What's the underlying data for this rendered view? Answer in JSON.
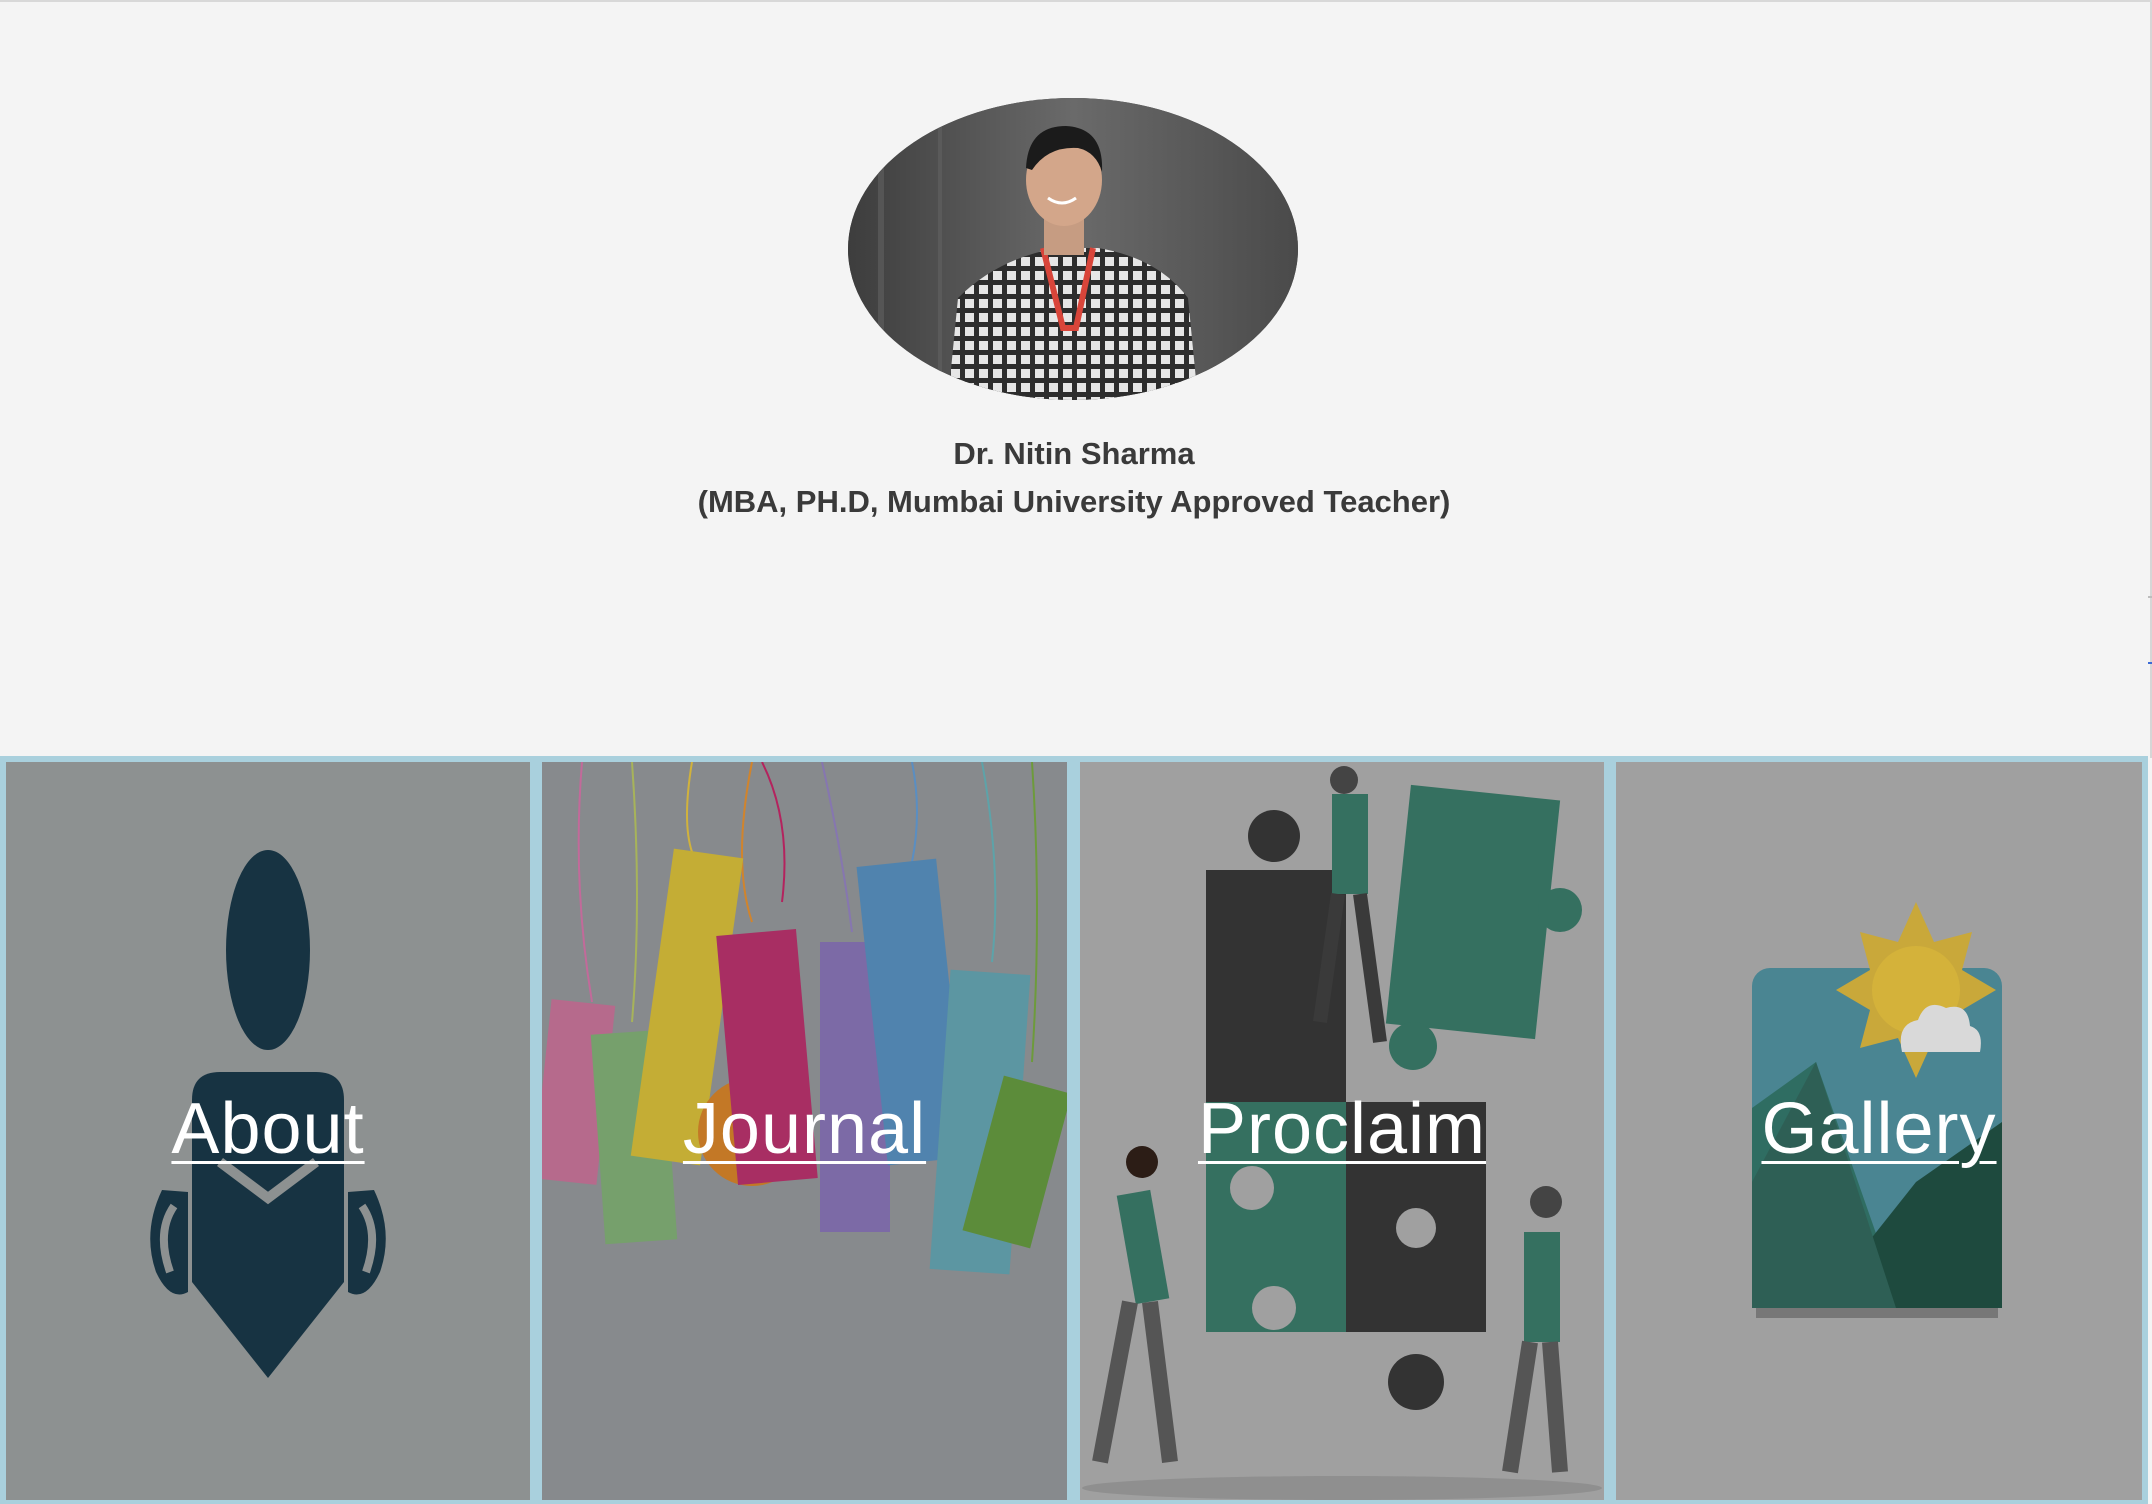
{
  "profile": {
    "name": "Dr. Nitin Sharma",
    "credentials": "(MBA, PH.D, Mumbai University Approved Teacher)"
  },
  "nav_tiles": [
    {
      "label": "About"
    },
    {
      "label": "Journal"
    },
    {
      "label": "Proclaim"
    },
    {
      "label": "Gallery"
    }
  ],
  "colors": {
    "page_background": "#f4f4f4",
    "tile_border": "#a9d0dd",
    "name_text": "#3a3a3a",
    "tile_label": "#ffffff"
  }
}
